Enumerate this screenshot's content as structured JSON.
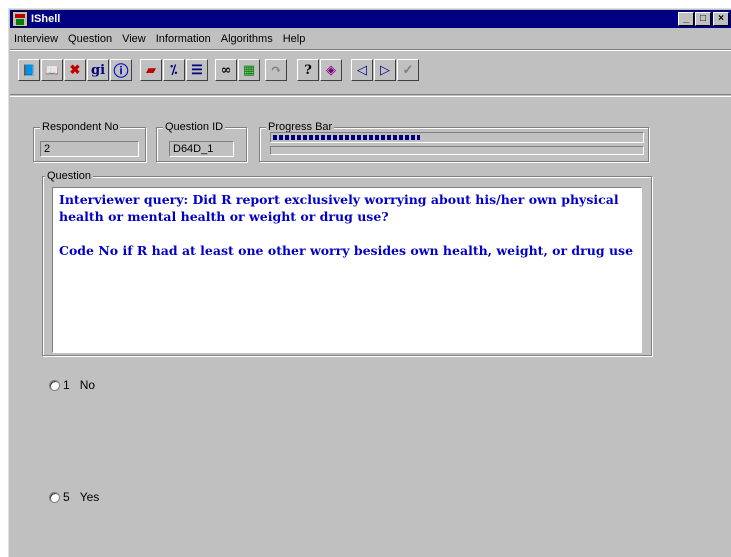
{
  "window": {
    "title": "IShell",
    "buttons": {
      "minimize": "_",
      "maximize": "□",
      "close": "×"
    }
  },
  "menu": [
    "Interview",
    "Question",
    "View",
    "Information",
    "Algorithms",
    "Help"
  ],
  "toolbar": {
    "group1": [
      {
        "icon": "book-icon",
        "glyph": "📘"
      },
      {
        "icon": "open-book-icon",
        "glyph": "📖"
      },
      {
        "icon": "delete-icon",
        "glyph": "✖"
      },
      {
        "icon": "gi-icon",
        "glyph": "gi"
      },
      {
        "icon": "info-icon",
        "glyph": "ⓘ"
      }
    ],
    "group2": [
      {
        "icon": "eraser-icon",
        "glyph": "▰"
      },
      {
        "icon": "translate-icon",
        "glyph": "⁒"
      },
      {
        "icon": "checklist-icon",
        "glyph": "☰"
      }
    ],
    "group3": [
      {
        "icon": "glasses-icon",
        "glyph": "∞"
      },
      {
        "icon": "color-palette-icon",
        "glyph": "▦"
      }
    ],
    "group4": [
      {
        "icon": "skip-icon",
        "glyph": "↷"
      }
    ],
    "group5": [
      {
        "icon": "help-icon",
        "glyph": "?"
      },
      {
        "icon": "notebook-icon",
        "glyph": "◈"
      }
    ],
    "group6": [
      {
        "icon": "previous-icon",
        "glyph": "◁"
      },
      {
        "icon": "next-icon",
        "glyph": "▷"
      },
      {
        "icon": "check-icon",
        "glyph": "✓"
      }
    ]
  },
  "respondent": {
    "label": "Respondent No",
    "value": "2"
  },
  "question_id": {
    "label": "Question ID",
    "value": "D64D_1"
  },
  "progress": {
    "label": "Progress Bar",
    "fraction": 0.4
  },
  "question": {
    "label": "Question",
    "paragraph1": "Interviewer query: Did R report exclusively worrying about his/her own physical health or mental health or weight or drug use?",
    "paragraph2": "Code No if R had at least one other worry besides own health, weight, or drug use"
  },
  "options": [
    {
      "code": "1",
      "label": "No"
    },
    {
      "code": "5",
      "label": "Yes"
    }
  ],
  "colors": {
    "titlebar": "#000080",
    "question_text": "#0000c8",
    "face": "#c0c0c0"
  }
}
